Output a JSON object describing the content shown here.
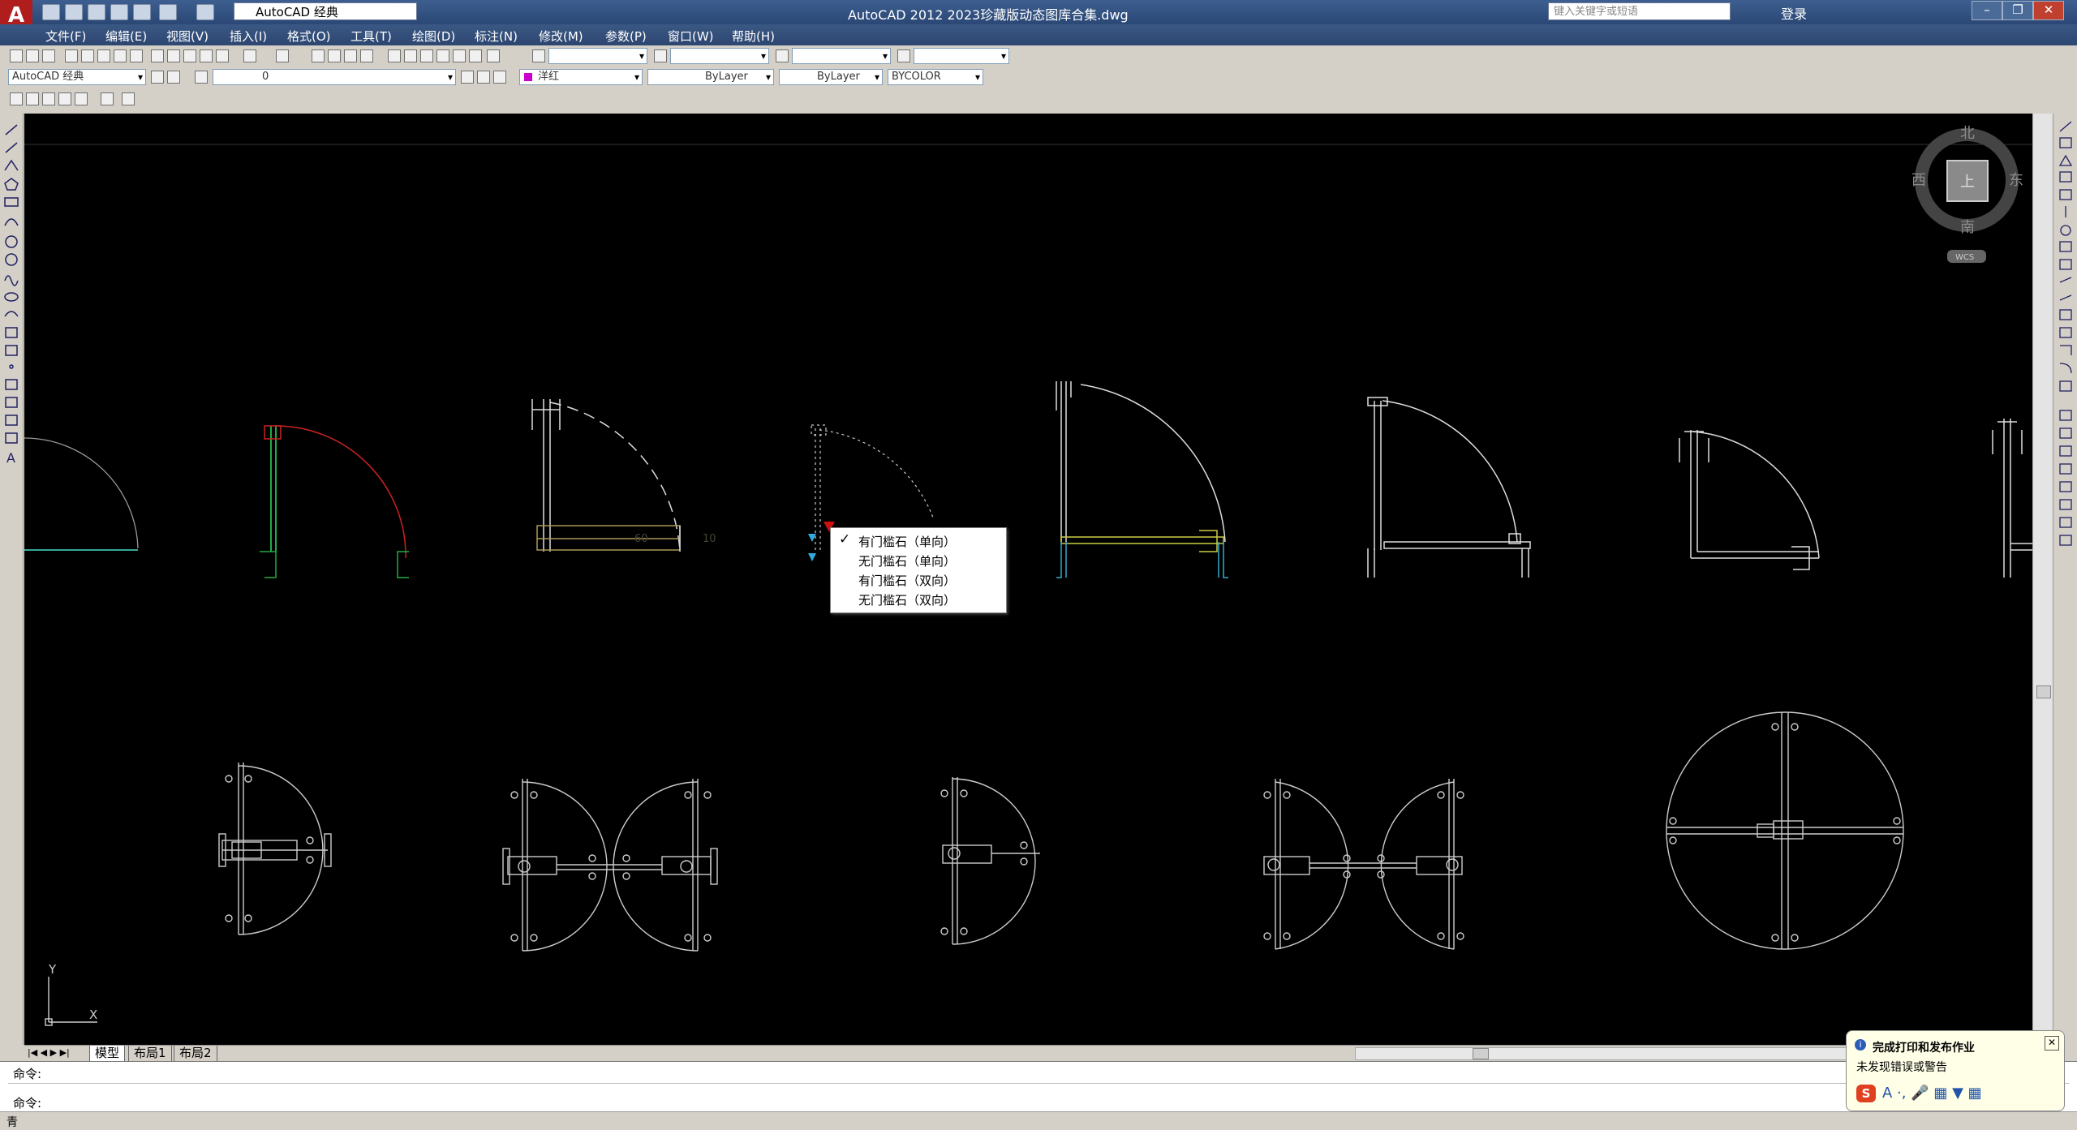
{
  "window": {
    "app_title": "AutoCAD 2012    2023珍藏版动态图库合集.dwg",
    "workspace": "AutoCAD 经典",
    "search_placeholder": "键入关键字或短语",
    "login": "登录"
  },
  "menu": [
    "文件(F)",
    "编辑(E)",
    "视图(V)",
    "插入(I)",
    "格式(O)",
    "工具(T)",
    "绘图(D)",
    "标注(N)",
    "修改(M)",
    "参数(P)",
    "窗口(W)",
    "帮助(H)"
  ],
  "toolbar2": {
    "workspace_combo": "AutoCAD 经典",
    "layer_combo": "0",
    "color_combo": "洋红",
    "linetype_combo": "ByLayer",
    "lineweight_combo": "ByLayer",
    "plotstyle_combo": "BYCOLOR"
  },
  "viewcube": {
    "north": "北",
    "south": "南",
    "east": "东",
    "west": "西",
    "top": "上",
    "wcs": "WCS"
  },
  "context_menu": {
    "items": [
      "有门槛石（单向）",
      "无门槛石（单向）",
      "有门槛石（双向）",
      "无门槛石（双向）"
    ],
    "checked_index": 0
  },
  "dimension_labels": [
    "60",
    "10"
  ],
  "ucs": {
    "x": "X",
    "y": "Y"
  },
  "tabs": [
    "模型",
    "布局1",
    "布局2"
  ],
  "command": {
    "line1": "命令:",
    "line2": "命令:"
  },
  "status_left": "青",
  "notification": {
    "title": "完成打印和发布作业",
    "message": "未发现错误或警告"
  },
  "colors": {
    "drawing_bg": "#000000",
    "door_red": "#cc2222",
    "door_green": "#22aa44",
    "cyan": "#33aacc",
    "yellow": "#cccc44"
  }
}
